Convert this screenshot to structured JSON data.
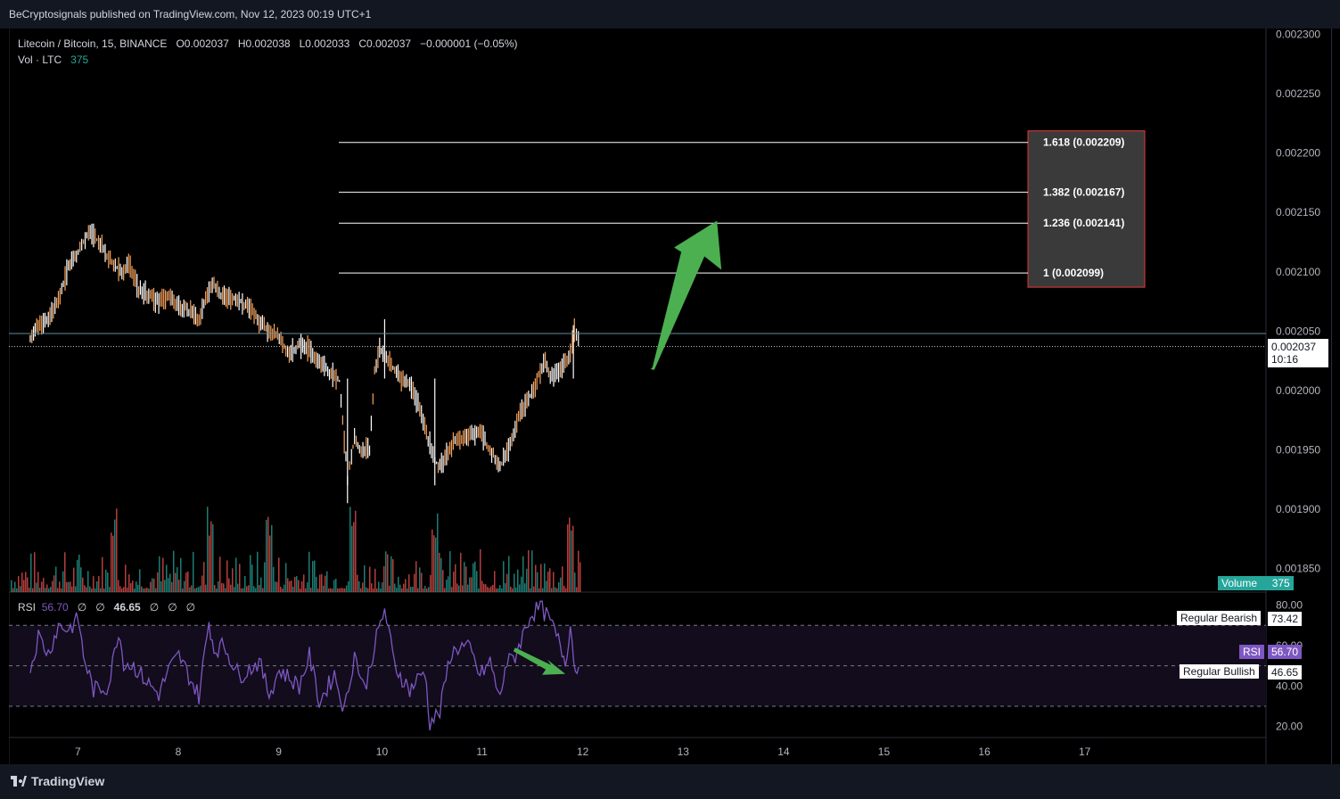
{
  "header": {
    "publisher_line": "BeCryptosignals published on TradingView.com, Nov 12, 2023 00:19 UTC+1"
  },
  "legend": {
    "symbol": "Litecoin / Bitcoin, 15, BINANCE",
    "open": "O0.002037",
    "high": "H0.002038",
    "low": "L0.002033",
    "close": "C0.002037",
    "change": "−0.000001 (−0.05%)",
    "vol_label": "Vol · LTC",
    "vol_value": "375"
  },
  "price_tag": {
    "price": "0.002037",
    "countdown": "10:16"
  },
  "volume_tag": {
    "label": "Volume",
    "value": "375"
  },
  "rsi_legend": {
    "label": "RSI",
    "value": "56.70",
    "placeholders": [
      "∅",
      "∅"
    ],
    "bullish_value": "46.65",
    "placeholders2": [
      "∅",
      "∅",
      "∅"
    ]
  },
  "rsi_tags": {
    "bearish_label": "Regular Bearish",
    "bearish_value": "73.42",
    "rsi_label": "RSI",
    "rsi_value": "56.70",
    "bullish_label": "Regular Bullish",
    "bullish_value": "46.65"
  },
  "footer": {
    "brand": "TradingView"
  },
  "colors": {
    "background": "#000000",
    "up": "#ffffff",
    "down": "#f7a35c",
    "volume_up": "#26a69a",
    "volume_down": "#ef5350",
    "rsi": "#7e57c2",
    "arrow": "#4caf50",
    "fib_box_border": "#e53935",
    "fib_box_fill": "#3a3a3a"
  },
  "chart_data": [
    {
      "type": "line",
      "title": "Litecoin / Bitcoin, 15, BINANCE",
      "x_ticks": [
        "7",
        "8",
        "9",
        "10",
        "11",
        "12",
        "13",
        "14",
        "15",
        "16",
        "17"
      ],
      "y_ticks": [
        "0.002300",
        "0.002250",
        "0.002200",
        "0.002150",
        "0.002100",
        "0.002050",
        "0.002000",
        "0.001950",
        "0.001900",
        "0.001850"
      ],
      "ylim": [
        0.00183,
        0.002305
      ],
      "xlim": [
        6.52,
        19.0
      ],
      "price_path": {
        "x": [
          6.52,
          6.6,
          6.7,
          6.8,
          6.9,
          6.98,
          7.05,
          7.1,
          7.2,
          7.3,
          7.4,
          7.45,
          7.5,
          7.6,
          7.7,
          7.8,
          7.9,
          8.0,
          8.1,
          8.2,
          8.3,
          8.35,
          8.42,
          8.5,
          8.6,
          8.7,
          8.8,
          8.9,
          9.0,
          9.1,
          9.2,
          9.3,
          9.4,
          9.5,
          9.6,
          9.68,
          9.72,
          9.75,
          9.8,
          9.9,
          9.95,
          10.0,
          10.05,
          10.1,
          10.2,
          10.3,
          10.4,
          10.5,
          10.55,
          10.6,
          10.7,
          10.75,
          10.8,
          10.9,
          11.0,
          11.1,
          11.2,
          11.25,
          11.3,
          11.4,
          11.5,
          11.6,
          11.65,
          11.7,
          11.8,
          11.9,
          11.94,
          12.0
        ],
        "close": [
          0.002045,
          0.002055,
          0.00206,
          0.002075,
          0.002105,
          0.002115,
          0.002125,
          0.002135,
          0.002125,
          0.002112,
          0.002102,
          0.002098,
          0.002108,
          0.002085,
          0.00208,
          0.002075,
          0.00208,
          0.00207,
          0.002068,
          0.00206,
          0.002085,
          0.00209,
          0.00208,
          0.002078,
          0.002075,
          0.00207,
          0.002058,
          0.00205,
          0.002045,
          0.00203,
          0.002038,
          0.002035,
          0.002025,
          0.002015,
          0.002008,
          0.001925,
          0.001945,
          0.00196,
          0.00195,
          0.00195,
          0.002015,
          0.002035,
          0.00203,
          0.002025,
          0.00201,
          0.002005,
          0.001985,
          0.001955,
          0.00194,
          0.001935,
          0.00195,
          0.00196,
          0.001958,
          0.001962,
          0.001965,
          0.00195,
          0.001935,
          0.001945,
          0.001955,
          0.00198,
          0.001995,
          0.002015,
          0.002025,
          0.00201,
          0.002018,
          0.00203,
          0.00205,
          0.002037
        ]
      },
      "last_price": 0.002037,
      "horizontal_line": 0.002048,
      "fibonacci_extension": [
        {
          "level": "1.618",
          "price": 0.002209,
          "label": "1.618 (0.002209)"
        },
        {
          "level": "1.382",
          "price": 0.002167,
          "label": "1.382 (0.002167)"
        },
        {
          "level": "1.236",
          "price": 0.002141,
          "label": "1.236 (0.002141)"
        },
        {
          "level": "1",
          "price": 0.002099,
          "label": "1 (0.002099)"
        }
      ],
      "fib_x_range": [
        9.6,
        16.4
      ],
      "arrow": {
        "from": [
          12.7,
          0.002018
        ],
        "to": [
          13.36,
          0.002143
        ]
      }
    },
    {
      "type": "line",
      "title": "RSI",
      "y_ticks": [
        "80.00",
        "60.00",
        "40.00",
        "20.00"
      ],
      "ylim": [
        15,
        86
      ],
      "bands": [
        70,
        50,
        30
      ],
      "rsi_path": {
        "x": [
          6.52,
          6.6,
          6.7,
          6.8,
          6.9,
          7.0,
          7.05,
          7.15,
          7.3,
          7.4,
          7.45,
          7.55,
          7.7,
          7.8,
          7.9,
          8.0,
          8.2,
          8.3,
          8.35,
          8.45,
          8.6,
          8.8,
          8.9,
          9.0,
          9.2,
          9.3,
          9.4,
          9.55,
          9.65,
          9.75,
          9.85,
          9.95,
          10.05,
          10.15,
          10.3,
          10.45,
          10.5,
          10.6,
          10.7,
          10.8,
          10.9,
          11.0,
          11.1,
          11.2,
          11.25,
          11.35,
          11.5,
          11.6,
          11.7,
          11.8,
          11.85,
          11.9,
          11.95,
          12.0
        ],
        "values": [
          48,
          65,
          56,
          70,
          68,
          73,
          55,
          38,
          40,
          68,
          52,
          50,
          41,
          36,
          48,
          55,
          35,
          72,
          58,
          60,
          45,
          52,
          36,
          48,
          40,
          55,
          32,
          46,
          28,
          56,
          38,
          60,
          78,
          50,
          38,
          48,
          22,
          27,
          55,
          60,
          58,
          45,
          52,
          33,
          50,
          55,
          75,
          79,
          72,
          60,
          52,
          70,
          47,
          57
        ]
      },
      "divergence_arrow": {
        "from": [
          11.35,
          59
        ],
        "to": [
          11.85,
          46
        ]
      }
    },
    {
      "type": "bar",
      "title": "Volume",
      "note": "volume histogram along bottom of price pane; last value 375"
    }
  ]
}
